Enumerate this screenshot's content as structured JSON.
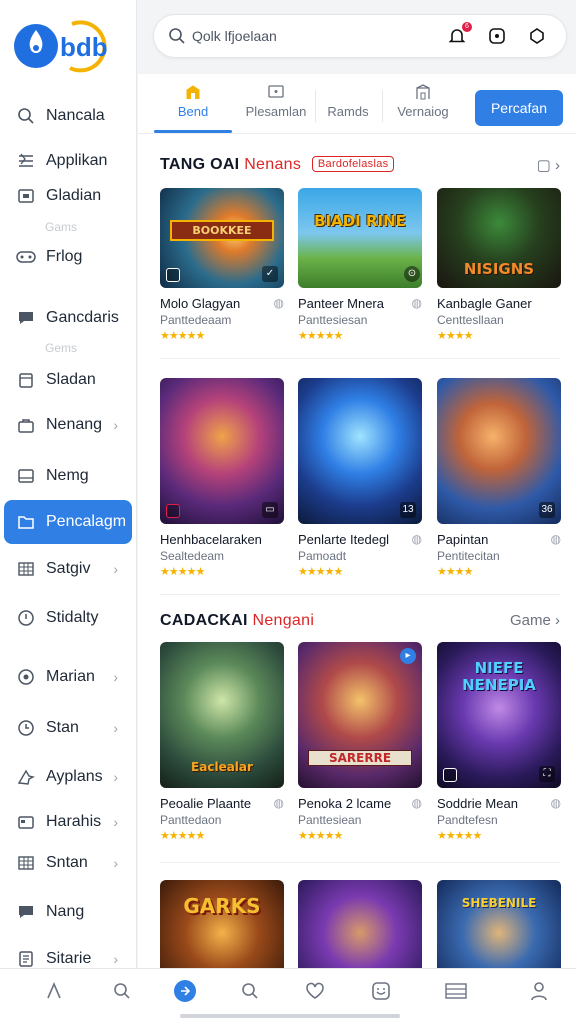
{
  "app": {
    "logo_text": "bdb",
    "search_placeholder": "Qolk lfjoelaan",
    "notif_count": "6"
  },
  "sidebar": {
    "items": [
      {
        "label": "Nancala",
        "icon": "search-icon",
        "chevron": false
      },
      {
        "label": "Applikan",
        "icon": "layers-icon",
        "chevron": false
      },
      {
        "label": "Gladian",
        "icon": "frame-icon",
        "chevron": false
      },
      {
        "label": "Frlog",
        "icon": "gamepad-icon",
        "chevron": false
      },
      {
        "label": "Gancdaris",
        "icon": "chat-icon",
        "chevron": false
      },
      {
        "label": "Sladan",
        "icon": "copy-icon",
        "chevron": false
      },
      {
        "label": "Nenang",
        "icon": "bag-icon",
        "chevron": true
      },
      {
        "label": "Nemg",
        "icon": "window-icon",
        "chevron": false
      },
      {
        "label": "Pencalagm",
        "icon": "folder-icon",
        "chevron": false
      },
      {
        "label": "Satgiv",
        "icon": "grid-icon",
        "chevron": true
      },
      {
        "label": "Stidalty",
        "icon": "circle-check-icon",
        "chevron": false
      },
      {
        "label": "Marian",
        "icon": "settings-icon",
        "chevron": true
      },
      {
        "label": "Stan",
        "icon": "clock-icon",
        "chevron": true
      },
      {
        "label": "Ayplans",
        "icon": "plane-icon",
        "chevron": true
      },
      {
        "label": "Harahis",
        "icon": "card-icon",
        "chevron": true
      },
      {
        "label": "Sntan",
        "icon": "grid-icon",
        "chevron": true
      },
      {
        "label": "Nang",
        "icon": "chat-icon",
        "chevron": false
      },
      {
        "label": "Sitarie",
        "icon": "doc-icon",
        "chevron": true
      }
    ],
    "sub_labels": [
      "Gams",
      "Gems"
    ]
  },
  "tabs": [
    {
      "label": "Bend",
      "active": true
    },
    {
      "label": "Plesamlan",
      "active": false
    },
    {
      "label": "Ramds",
      "active": false
    },
    {
      "label": "Vernaiog",
      "active": false
    }
  ],
  "primary_button": "Percafan",
  "sections": [
    {
      "title": "TANG OAI",
      "title_red": "Nenans",
      "pill": "Bardofelaslas",
      "more": "▢",
      "cards": [
        {
          "name": "Molo Glagyan",
          "sub": "Panttedeaam",
          "stars": "★★★★★",
          "banner": "BOOKKEE",
          "badge": ""
        },
        {
          "name": "Panteer Mnera",
          "sub": "Panttesiesan",
          "stars": "★★★★★",
          "banner": "BIADI RINE",
          "badge": ""
        },
        {
          "name": "Kanbagle Ganer",
          "sub": "Centtesllaan",
          "stars": "★★★★",
          "banner": "NISIGNS",
          "badge": ""
        },
        {
          "name": "Henhbacelaraken",
          "sub": "Sealtedeam",
          "stars": "★★★★★",
          "banner": "",
          "badge": ""
        },
        {
          "name": "Penlarte Itedegl",
          "sub": "Pamoadt",
          "stars": "★★★★★",
          "banner": "",
          "badge": "13"
        },
        {
          "name": "Papintan",
          "sub": "Pentitecitan",
          "stars": "★★★★",
          "banner": "",
          "badge": "36"
        }
      ]
    },
    {
      "title": "CADACKAI",
      "title_red": "Nengani",
      "pill": "",
      "more": "Game",
      "cards": [
        {
          "name": "Peoalie Plaante",
          "sub": "Panttedaon",
          "stars": "★★★★★",
          "banner": "Eaclealar",
          "badge": ""
        },
        {
          "name": "Penoka 2 lcame",
          "sub": "Panttesiean",
          "stars": "★★★★★",
          "banner": "SARERRE",
          "badge": ""
        },
        {
          "name": "Soddrie Mean",
          "sub": "Pandtefesn",
          "stars": "★★★★★",
          "banner": "NIEFE NENEPIA",
          "badge": ""
        },
        {
          "name": "",
          "sub": "",
          "stars": "",
          "banner": "GARKS",
          "badge": ""
        },
        {
          "name": "",
          "sub": "",
          "stars": "",
          "banner": "",
          "badge": ""
        },
        {
          "name": "",
          "sub": "",
          "stars": "",
          "banner": "SHEBENILE",
          "badge": ""
        }
      ]
    }
  ],
  "bottom_nav": [
    {
      "icon": "home-icon",
      "active": false
    },
    {
      "icon": "search-icon",
      "active": false
    },
    {
      "icon": "compass-icon",
      "active": true
    },
    {
      "icon": "search-icon",
      "active": false
    },
    {
      "icon": "heart-icon",
      "active": false
    },
    {
      "icon": "gamepad-icon",
      "active": false
    },
    {
      "icon": "list-icon",
      "active": false
    },
    {
      "icon": "user-icon",
      "active": false
    }
  ],
  "colors": {
    "accent": "#2f7fe5",
    "red": "#dc2626",
    "star": "#f5b301"
  }
}
